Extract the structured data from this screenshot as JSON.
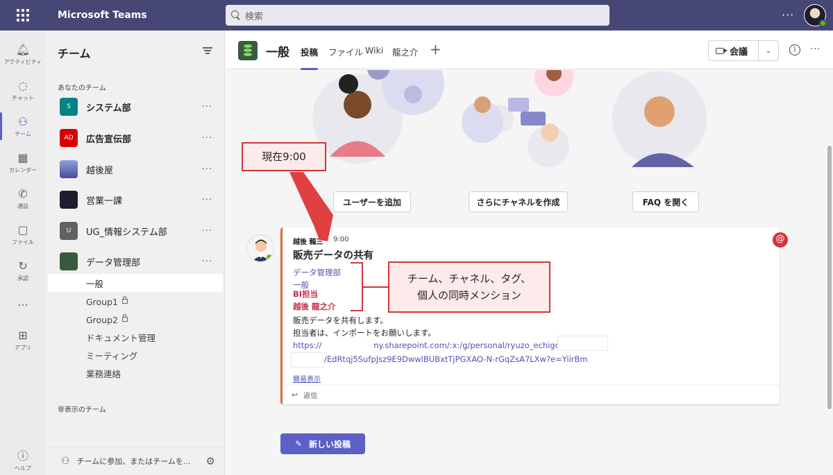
{
  "app": {
    "title": "Microsoft Teams"
  },
  "search": {
    "placeholder": "検索"
  },
  "rail": [
    {
      "label": "アクティビティ",
      "icon": "bell-icon"
    },
    {
      "label": "チャット",
      "icon": "chat-icon"
    },
    {
      "label": "チーム",
      "icon": "teams-icon"
    },
    {
      "label": "カレンダー",
      "icon": "calendar-icon"
    },
    {
      "label": "通話",
      "icon": "phone-icon"
    },
    {
      "label": "ファイル",
      "icon": "file-icon"
    },
    {
      "label": "承認",
      "icon": "approval-icon"
    },
    {
      "label": "...",
      "icon": "more-icon"
    },
    {
      "label": "アプリ",
      "icon": "apps-icon"
    },
    {
      "label": "ヘルプ",
      "icon": "help-icon"
    }
  ],
  "sidebar": {
    "title": "チーム",
    "section_mine": "あなたのチーム",
    "section_hidden": "非表示のチーム",
    "teams": [
      {
        "name": "システム部",
        "initials": "S",
        "color": "#038387"
      },
      {
        "name": "広告宣伝部",
        "initials": "AD",
        "color": "#d70000"
      },
      {
        "name": "越後屋",
        "initials": "",
        "color": "#6a6ab8"
      },
      {
        "name": "営業一課",
        "initials": "",
        "color": "#1e1e2e"
      },
      {
        "name": "UG_情報システム部",
        "initials": "U",
        "color": "#616161"
      },
      {
        "name": "データ管理部",
        "initials": "",
        "color": "#3a5a40"
      }
    ],
    "channels": [
      {
        "name": "一般"
      },
      {
        "name": "Group1"
      },
      {
        "name": "Group2"
      },
      {
        "name": "ドキュメント管理"
      },
      {
        "name": "ミーティング"
      },
      {
        "name": "業務連絡"
      }
    ],
    "footer_text": "チームに参加、またはチームを..."
  },
  "channel_header": {
    "title": "一般",
    "tabs": [
      "投稿",
      "ファイル",
      "Wiki",
      "龍之介"
    ],
    "meet_label": "会議"
  },
  "welcome": {
    "buttons": [
      "ユーザーを追加",
      "さらにチャネルを作成",
      "FAQ を開く"
    ]
  },
  "post": {
    "author": "越後 龍三",
    "time": "9:00",
    "subject": "販売データの共有",
    "mentions": [
      "データ管理部",
      "一般",
      "BI担当",
      "越後 龍之介"
    ],
    "body": [
      "販売データを共有します。",
      "担当者は、インポートをお願いします。"
    ],
    "link1": "https://",
    "link1b": "ny.sharepoint.com/:x:/g/personal/ryuzo_echigo_",
    "link2": "/EdRtqj5SufpJsz9E9DwwlBUBxtTjPGXAO-N-rGqZsA7LXw?e=YiirBm",
    "see_less": "簡易表示",
    "reply": "返信"
  },
  "new_post_label": "新しい投稿",
  "annotations": {
    "time_callout": "現在9:00",
    "mention_callout_1": "チーム、チャネル、タグ、",
    "mention_callout_2": "個人の同時メンション"
  },
  "colors": {
    "brand": "#464775",
    "accent": "#5b5fc7",
    "annotation": "#d13438"
  }
}
